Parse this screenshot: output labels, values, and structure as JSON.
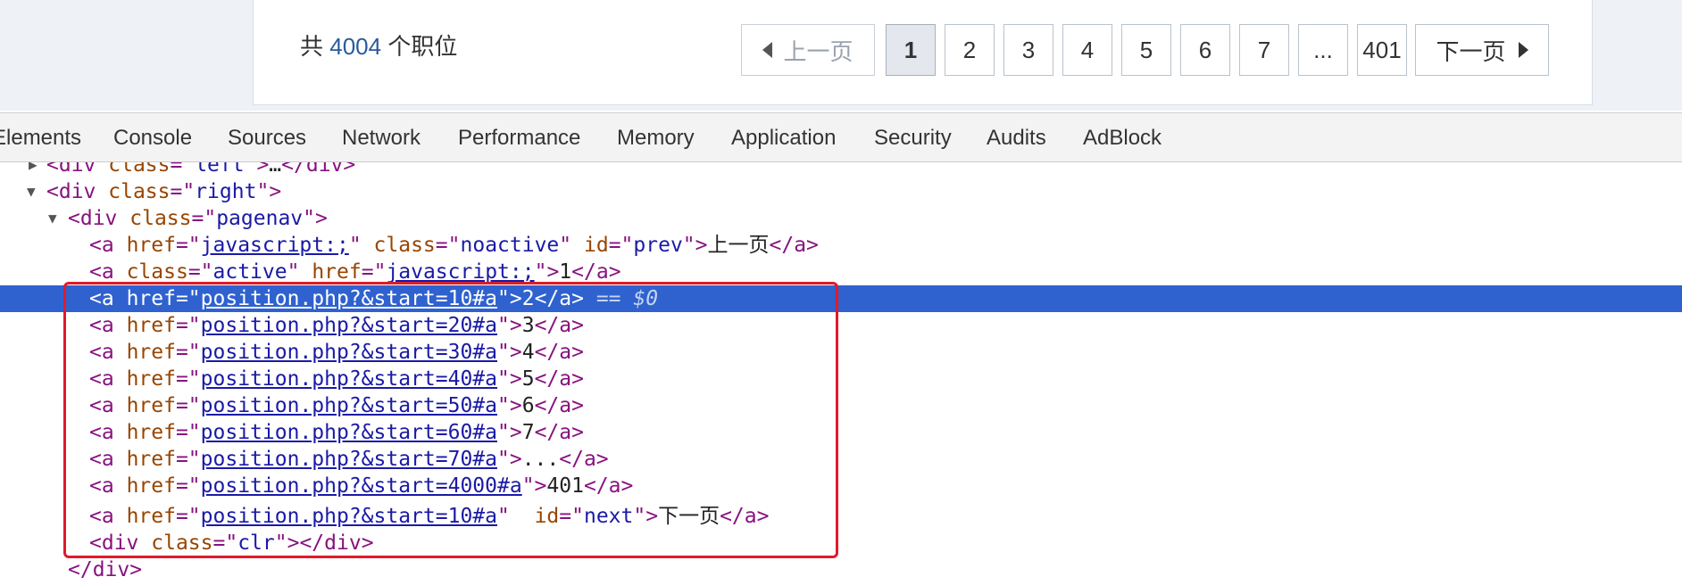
{
  "total": {
    "prefix": "共",
    "count": "4004",
    "suffix": "个职位"
  },
  "pagenav": {
    "prev_label": "上一页",
    "next_label": "下一页",
    "pages": [
      "1",
      "2",
      "3",
      "4",
      "5",
      "6",
      "7",
      "...",
      "401"
    ],
    "active_page": "1"
  },
  "devtools": {
    "tabs": [
      "Elements",
      "Console",
      "Sources",
      "Network",
      "Performance",
      "Memory",
      "Application",
      "Security",
      "Audits",
      "AdBlock"
    ],
    "active_tab": "Elements"
  },
  "dom": {
    "line_left": {
      "tag_open": "<div",
      "attr": "class",
      "value": "left",
      "ellipsis": "…",
      "tag_close": "</div>"
    },
    "line_right": {
      "tag_open": "<div",
      "attr": "class",
      "value": "right",
      "end": ">"
    },
    "line_pagenav": {
      "tag_open": "<div",
      "attr": "class",
      "value": "pagenav",
      "end": ">"
    },
    "line_prev": {
      "tag_open": "<a",
      "href_attr": "href",
      "href": "javascript:;",
      "class_attr": "class",
      "class_val": "noactive",
      "id_attr": "id",
      "id_val": "prev",
      "text": "上一页",
      "tag_close": "</a>"
    },
    "line_active": {
      "tag_open": "<a",
      "class_attr": "class",
      "class_val": "active",
      "href_attr": "href",
      "href": "javascript:;",
      "text": "1",
      "tag_close": "</a>"
    },
    "selected_marker": "== $0",
    "page_links": [
      {
        "href": "position.php?&start=10#a",
        "text": "2"
      },
      {
        "href": "position.php?&start=20#a",
        "text": "3"
      },
      {
        "href": "position.php?&start=30#a",
        "text": "4"
      },
      {
        "href": "position.php?&start=40#a",
        "text": "5"
      },
      {
        "href": "position.php?&start=50#a",
        "text": "6"
      },
      {
        "href": "position.php?&start=60#a",
        "text": "7"
      },
      {
        "href": "position.php?&start=70#a",
        "text": "..."
      },
      {
        "href": "position.php?&start=4000#a",
        "text": "401"
      }
    ],
    "line_next": {
      "tag_open": "<a",
      "href_attr": "href",
      "href": "position.php?&start=10#a",
      "id_attr": "id",
      "id_val": "next",
      "text": "下一页",
      "tag_close": "</a>"
    },
    "line_clr": {
      "tag_open": "<div",
      "attr": "class",
      "value": "clr",
      "tag_close": "</div>"
    },
    "line_div_close": "</div>"
  }
}
